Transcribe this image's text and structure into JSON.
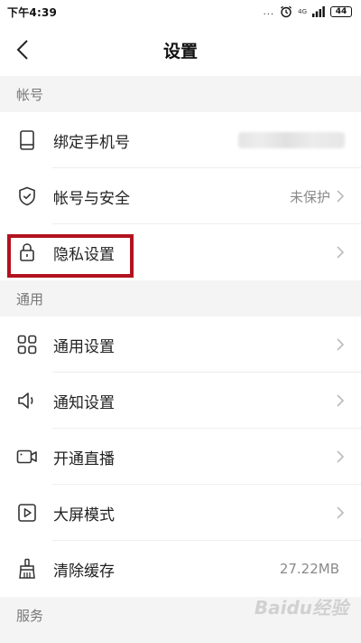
{
  "status_bar": {
    "time": "下午4:39",
    "dots": "...",
    "network": "4G",
    "battery": "44"
  },
  "navbar": {
    "title": "设置"
  },
  "sections": {
    "account": {
      "header": "帐号",
      "bind_phone": {
        "label": "绑定手机号",
        "value": ""
      },
      "account_security": {
        "label": "帐号与安全",
        "value": "未保护"
      },
      "privacy": {
        "label": "隐私设置"
      }
    },
    "general": {
      "header": "通用",
      "general_settings": {
        "label": "通用设置"
      },
      "notification_settings": {
        "label": "通知设置"
      },
      "live_stream": {
        "label": "开通直播"
      },
      "big_screen": {
        "label": "大屏模式"
      },
      "clear_cache": {
        "label": "清除缓存",
        "value": "27.22MB"
      }
    },
    "service": {
      "header": "服务"
    }
  },
  "icons": {
    "back": "chevron-left-icon",
    "phone": "phone-icon",
    "shield": "shield-check-icon",
    "lock": "lock-icon",
    "grid": "grid-icon",
    "speaker": "speaker-icon",
    "video": "video-camera-icon",
    "play": "play-screen-icon",
    "broom": "broom-icon",
    "chevron": "chevron-right-icon"
  },
  "colors": {
    "highlight": "#b3121f",
    "background": "#f4f4f4",
    "icon": "#333333",
    "chevron": "#bbbbbb"
  },
  "watermark": "Baidu经验"
}
